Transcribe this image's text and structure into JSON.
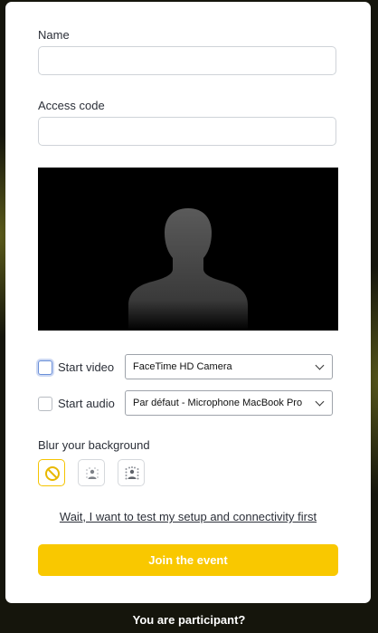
{
  "form": {
    "name_label": "Name",
    "name_value": "",
    "access_code_label": "Access code",
    "access_code_value": ""
  },
  "devices": {
    "start_video_label": "Start video",
    "start_video_checked": false,
    "camera_selected": "FaceTime HD Camera",
    "start_audio_label": "Start audio",
    "start_audio_checked": false,
    "microphone_selected": "Par défaut - Microphone MacBook Pro"
  },
  "blur": {
    "title": "Blur your background",
    "options": [
      {
        "icon": "no-blur-icon",
        "selected": true
      },
      {
        "icon": "slight-blur-icon",
        "selected": false
      },
      {
        "icon": "strong-blur-icon",
        "selected": false
      }
    ]
  },
  "test_link": "Wait, I want to test my setup and connectivity first",
  "join_button": "Join the event",
  "footer_question": "You are participant?",
  "colors": {
    "accent": "#f9c800",
    "background": "#15150c",
    "card": "#ffffff"
  }
}
